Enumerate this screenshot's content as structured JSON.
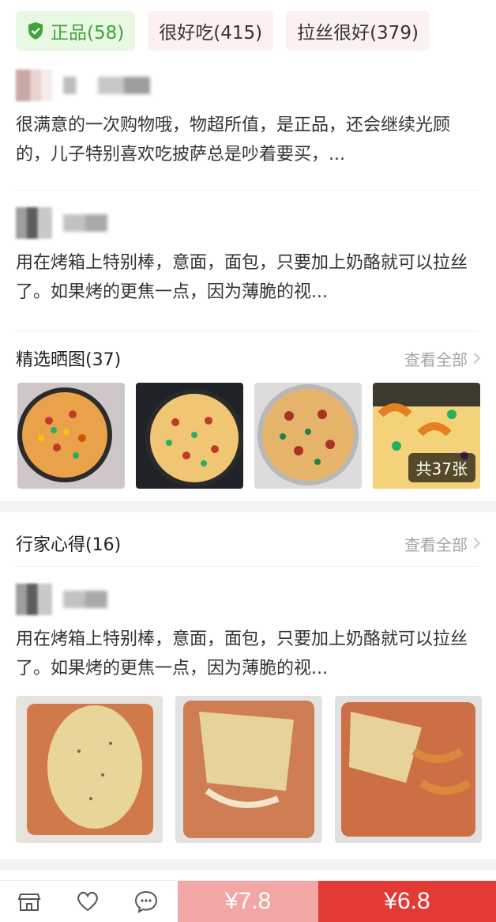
{
  "tags": [
    {
      "label": "正品(58)",
      "icon": "shield-check-icon",
      "color": "#3fa33a"
    },
    {
      "label": "很好吃(415)"
    },
    {
      "label": "拉丝很好(379)"
    }
  ],
  "reviews": [
    {
      "text": "很满意的一次购物哦，物超所值，是正品，还会继续光顾的，儿子特别喜欢吃披萨总是吵着要买，..."
    },
    {
      "text": "用在烤箱上特别棒，意面，面包，只要加上奶酪就可以拉丝了。如果烤的更焦一点，因为薄脆的视..."
    }
  ],
  "photos_section": {
    "title": "精选晒图(37)",
    "see_all": "查看全部",
    "count_badge": "共37张",
    "thumbnails": [
      "pizza-photo-1",
      "pizza-photo-2",
      "pizza-photo-3",
      "pizza-photo-4"
    ]
  },
  "expert_section": {
    "title": "行家心得(16)",
    "see_all": "查看全部",
    "review_text": "用在烤箱上特别棒，意面，面包，只要加上奶酪就可以拉丝了。如果烤的更焦一点，因为薄脆的视...",
    "photos": [
      "pasta-photo-1",
      "pasta-photo-2",
      "pasta-photo-3"
    ]
  },
  "bottom_bar": {
    "icons": [
      "store-icon",
      "heart-icon",
      "chat-icon"
    ],
    "price_left": "¥7.8",
    "price_right": "¥6.8",
    "colors": {
      "left": "#f2a6a6",
      "right": "#e33a35"
    }
  }
}
